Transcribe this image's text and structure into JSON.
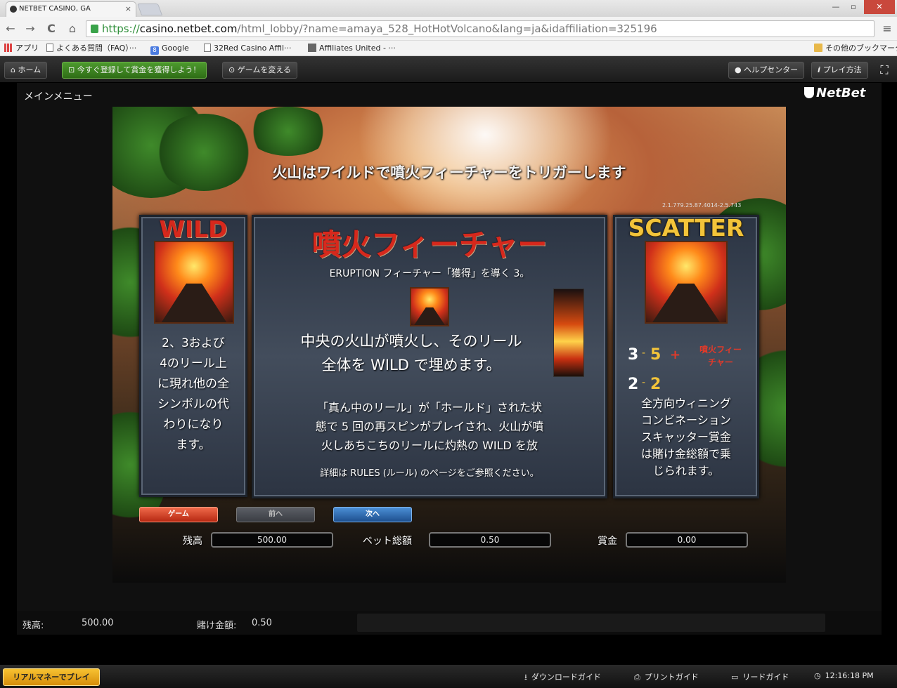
{
  "browser": {
    "tab_title": "NETBET CASINO, GA",
    "tab_close": "×",
    "window_controls": {
      "minimize": "—",
      "maximize": "▫",
      "close": "✕"
    },
    "url": {
      "scheme": "https://",
      "host": "casino.netbet.com",
      "path": "/html_lobby/?name=amaya_528_HotHotVolcano&lang=ja&idaffiliation=325196"
    },
    "nav_icons": {
      "back": "←",
      "forward": "→",
      "reload": "C",
      "home": "⌂",
      "star": "☆",
      "menu": "≡"
    },
    "bookmarks": [
      {
        "label": "アプリ",
        "icon": "apps-icon"
      },
      {
        "label": "よくある質問（FAQ）···",
        "icon": "page-icon"
      },
      {
        "label": "Google",
        "icon": "google-icon"
      },
      {
        "label": "32Red Casino Affil···",
        "icon": "page-icon"
      },
      {
        "label": "Affiliates United - ···",
        "icon": "affiliates-icon"
      }
    ],
    "other_bookmarks": "その他のブックマーク"
  },
  "site": {
    "home": "ホーム",
    "register": "今すぐ登録して賞金を獲得しよう！",
    "change_game": "ゲームを変える",
    "help_center": "ヘルプセンター",
    "how_to_play": "プレイ方法",
    "fullscreen_icon": "⛶"
  },
  "game": {
    "main_menu": "メインメニュー",
    "logo": "NetBet",
    "headline": "火山はワイルドで噴火フィーチャーをトリガーします",
    "version": "2.1.779.25.87.4014-2.5.743",
    "wild": {
      "title": "WILD",
      "text": [
        "2、3および",
        "4のリール上",
        "に現れ他の全",
        "シンボルの代",
        "わりになり",
        "ます。"
      ]
    },
    "eruption": {
      "title": "噴火フィーチャー",
      "subtitle": "ERUPTION フィーチャー「獲得」を導く 3。",
      "text1": [
        "中央の火山が噴火し、そのリール",
        "全体を WILD で埋めます。"
      ],
      "text2": [
        "「真ん中のリール」が「ホールド」された状",
        "態で 5 回の再スピンがプレイされ、火山が噴",
        "火しあちこちのリールに灼熱の WILD を放"
      ],
      "footnote": "詳細は RULES (ルール) のページをご参照ください。"
    },
    "scatter": {
      "title": "SCATTER",
      "row1": {
        "a": "3",
        "dash1": "-",
        "b": "5",
        "plus": "+",
        "feature": [
          "噴火フィー",
          "チャー"
        ]
      },
      "row2": {
        "a": "2",
        "dash1": "-",
        "b": "2"
      },
      "text": [
        "全方向ウィニング",
        "コンビネーション",
        "スキャッター賞金",
        "は賭け金総額で乗",
        "じられます。"
      ]
    },
    "controls": {
      "btn1": "ゲーム",
      "btn2": "前へ",
      "btn3": "次へ"
    },
    "stats": {
      "balance_label": "残高",
      "balance_value": "500.00",
      "bet_label": "ベット総額",
      "bet_value": "0.50",
      "win_label": "賞金",
      "win_value": "0.00"
    }
  },
  "status": {
    "balance_label": "残高:",
    "balance_value": "500.00",
    "bet_label": "賭け金額:",
    "bet_value": "0.50"
  },
  "footer": {
    "real_money": "リアルマネーでプレイ",
    "download_guide": "ダウンロードガイド",
    "print_guide": "プリントガイド",
    "read_guide": "リードガイド",
    "time": "12:16:18 PM"
  }
}
